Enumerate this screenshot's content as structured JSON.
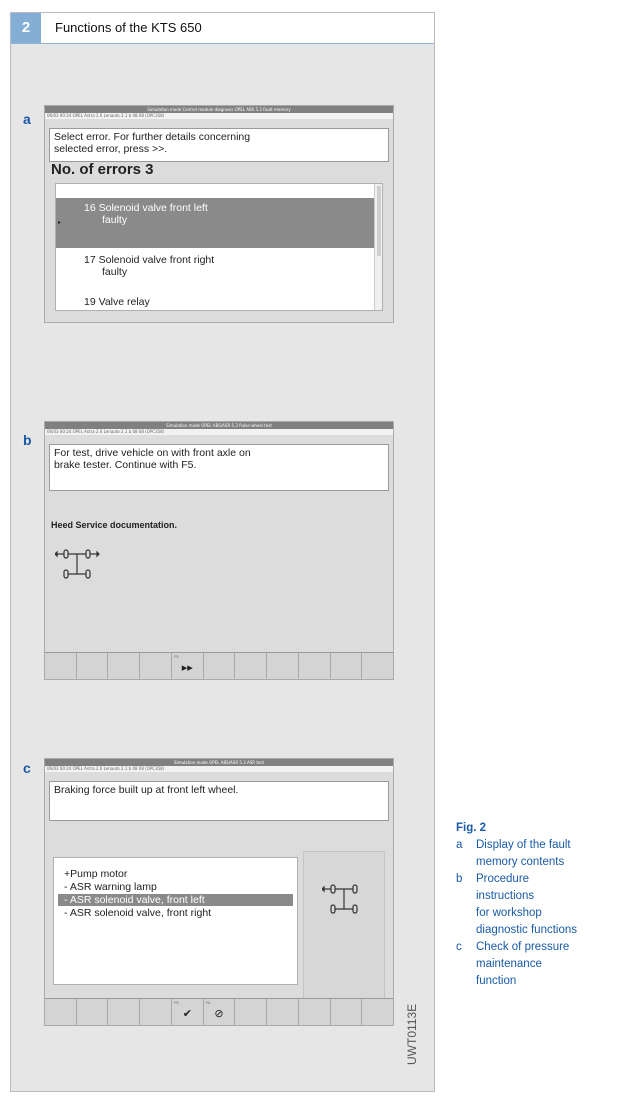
{
  "header": {
    "number": "2",
    "title": "Functions of the KTS 650"
  },
  "panel_a": {
    "label": "a",
    "titlebar": "Simulation mode Control module diagnosis OPEL ABS 5.3 Fault memory",
    "statusbar": "06/03 00:24  OPEL  Astra 2.0 Lenauto  2.1 b  08 08 (OPC358)",
    "message": [
      "Select error. For further details concerning",
      "selected error, press >>."
    ],
    "error_heading": "No. of errors 3",
    "errors": [
      {
        "lines": [
          "16  Solenoid valve front left",
          "faulty"
        ],
        "selected": true
      },
      {
        "lines": [
          "17  Solenoid valve front right",
          "faulty"
        ],
        "selected": false
      },
      {
        "lines": [
          "19  Valve relay"
        ],
        "selected": false
      }
    ]
  },
  "panel_b": {
    "label": "b",
    "titlebar": "Simulation mode OPEL ABS/ASR 5.3 Pulse-wheel test",
    "statusbar": "06/03 00:24  OPEL  Astra 2.0 Lenauto  2.1 b  08 08 (OPC358)",
    "message": [
      "For test, drive vehicle on with front axle on",
      "brake tester. Continue with F5."
    ],
    "heed": "Heed Service documentation.",
    "fkey_label": "F5",
    "fkey_icon": "fast-forward-icon"
  },
  "panel_c": {
    "label": "c",
    "titlebar": "Simulation mode OPEL ABS/ASR 5.3 ASR test",
    "statusbar": "06/03 00:24  OPEL  Astra 2.0 Lenauto  2.1 b  08 08 (OPC358)",
    "message": [
      "Braking force built up at front left wheel."
    ],
    "components": [
      {
        "text": "+Pump motor",
        "selected": false
      },
      {
        "text": "- ASR warning lamp",
        "selected": false
      },
      {
        "text": "- ASR solenoid valve, front left",
        "selected": true
      },
      {
        "text": "- ASR solenoid valve, front right",
        "selected": false
      }
    ],
    "fkeys": [
      {
        "label": "F5",
        "icon": "checkmark-icon",
        "glyph": "✔"
      },
      {
        "label": "F6",
        "icon": "cancel-icon",
        "glyph": "⊘"
      }
    ]
  },
  "vertical_text": "UWT0113E",
  "caption": {
    "title": "Fig. 2",
    "items": [
      {
        "letter": "a",
        "lines": [
          "Display of the fault",
          "memory contents"
        ]
      },
      {
        "letter": "b",
        "lines": [
          "Procedure",
          "instructions",
          "for workshop",
          "diagnostic functions"
        ]
      },
      {
        "letter": "c",
        "lines": [
          "Check of pressure",
          "maintenance",
          "function"
        ]
      }
    ]
  },
  "colors": {
    "accent": "#85aed6",
    "label_blue": "#1a5aa6",
    "frame_bg": "#e6e6e6",
    "highlight": "#8a8a8a"
  }
}
